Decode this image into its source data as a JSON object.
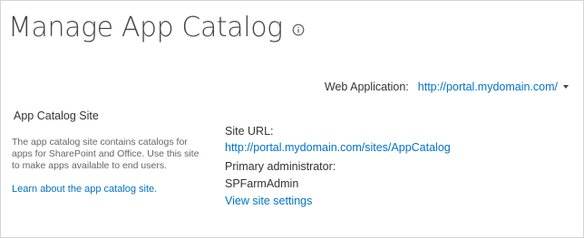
{
  "header": {
    "title": "Manage App Catalog",
    "info_icon": "info-circle-icon"
  },
  "web_application": {
    "label": "Web Application:",
    "value": "http://portal.mydomain.com/",
    "dropdown_icon": "caret-down-icon"
  },
  "section": {
    "title": "App Catalog Site",
    "description": "The app catalog site contains catalogs for apps for SharePoint and Office. Use this site to make apps available to end users.",
    "learn_link": "Learn about the app catalog site."
  },
  "details": {
    "site_url_label": "Site URL:",
    "site_url_value": "http://portal.mydomain.com/sites/AppCatalog",
    "primary_admin_label": "Primary administrator:",
    "primary_admin_value": "SPFarmAdmin",
    "view_settings_link": "View site settings"
  },
  "colors": {
    "link": "#0072c6",
    "title_text": "#444444",
    "body_text": "#333333",
    "muted_text": "#666666"
  }
}
